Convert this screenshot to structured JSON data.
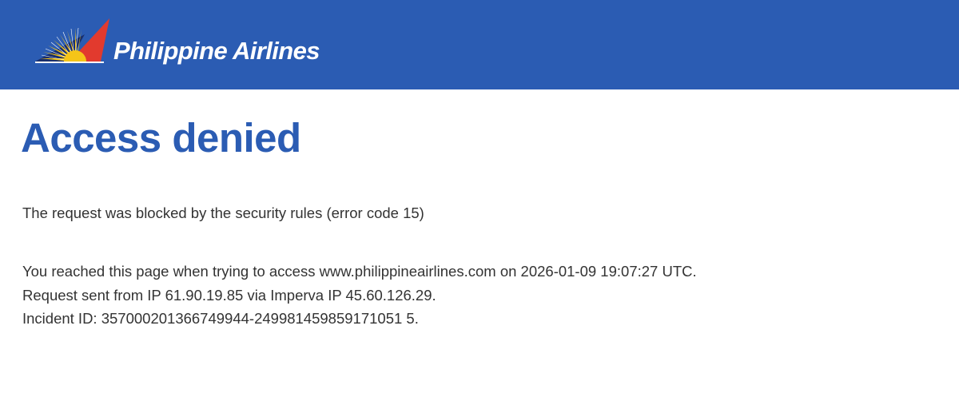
{
  "header": {
    "brand_name": "Philippine Airlines",
    "logo_icon": "philippine-airlines-sunburst-logo-icon",
    "background_color": "#2b5cb3"
  },
  "main": {
    "title": "Access denied",
    "title_color": "#2b5cb3",
    "block_message": "The request was blocked by the security rules (error code 15)",
    "details": {
      "line1": "You reached this page when trying to access www.philippineairlines.com on 2026-01-09 19:07:27 UTC.",
      "line2": "Request sent from IP 61.90.19.85 via Imperva IP 45.60.126.29.",
      "line3": "Incident ID: 357000201366749944-249981459859171051 5."
    }
  }
}
